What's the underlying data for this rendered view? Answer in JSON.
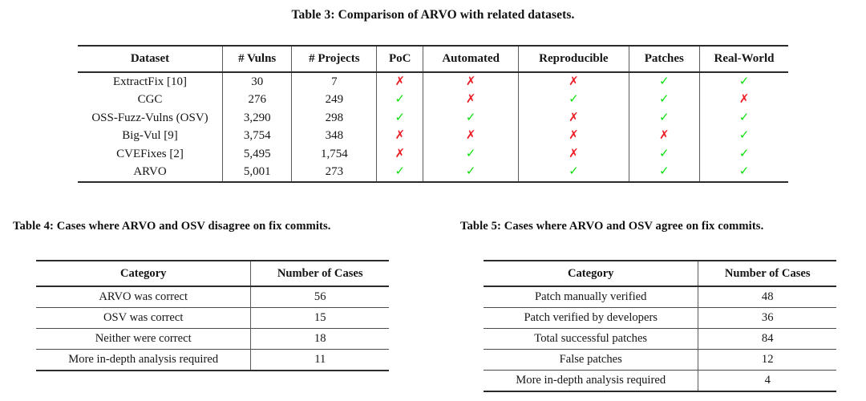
{
  "table3": {
    "caption": "Table 3: Comparison of ARVO with related datasets.",
    "columns": [
      "Dataset",
      "# Vulns",
      "# Projects",
      "PoC",
      "Automated",
      "Reproducible",
      "Patches",
      "Real-World"
    ],
    "marks": {
      "yes": "✓",
      "no": "✗"
    },
    "colors": {
      "yes": "#0ce00c",
      "no": "#ed1c24"
    },
    "rows": [
      {
        "dataset": "ExtractFix [10]",
        "vulns": "30",
        "projects": "7",
        "poc": "✗",
        "automated": "✗",
        "reproducible": "✗",
        "patches": "✓",
        "real_world": "✓"
      },
      {
        "dataset": "CGC",
        "vulns": "276",
        "projects": "249",
        "poc": "✓",
        "automated": "✗",
        "reproducible": "✓",
        "patches": "✓",
        "real_world": "✗"
      },
      {
        "dataset": "OSS-Fuzz-Vulns (OSV)",
        "vulns": "3,290",
        "projects": "298",
        "poc": "✓",
        "automated": "✓",
        "reproducible": "✗",
        "patches": "✓",
        "real_world": "✓"
      },
      {
        "dataset": "Big-Vul [9]",
        "vulns": "3,754",
        "projects": "348",
        "poc": "✗",
        "automated": "✗",
        "reproducible": "✗",
        "patches": "✗",
        "real_world": "✓"
      },
      {
        "dataset": "CVEFixes [2]",
        "vulns": "5,495",
        "projects": "1,754",
        "poc": "✗",
        "automated": "✓",
        "reproducible": "✗",
        "patches": "✓",
        "real_world": "✓"
      },
      {
        "dataset": "ARVO",
        "vulns": "5,001",
        "projects": "273",
        "poc": "✓",
        "automated": "✓",
        "reproducible": "✓",
        "patches": "✓",
        "real_world": "✓"
      }
    ]
  },
  "table4": {
    "caption": "Table 4: Cases where ARVO and OSV disagree on fix commits.",
    "columns": [
      "Category",
      "Number of Cases"
    ],
    "rows": [
      {
        "category": "ARVO was correct",
        "count": "56"
      },
      {
        "category": "OSV was correct",
        "count": "15"
      },
      {
        "category": "Neither were correct",
        "count": "18"
      },
      {
        "category": "More in-depth analysis required",
        "count": "11"
      }
    ]
  },
  "table5": {
    "caption": "Table 5: Cases where ARVO and OSV agree on fix commits.",
    "columns": [
      "Category",
      "Number of Cases"
    ],
    "rows": [
      {
        "category": "Patch manually verified",
        "count": "48"
      },
      {
        "category": "Patch verified by developers",
        "count": "36"
      },
      {
        "category": "Total successful patches",
        "count": "84"
      },
      {
        "category": "False patches",
        "count": "12"
      },
      {
        "category": "More in-depth analysis required",
        "count": "4"
      }
    ]
  }
}
